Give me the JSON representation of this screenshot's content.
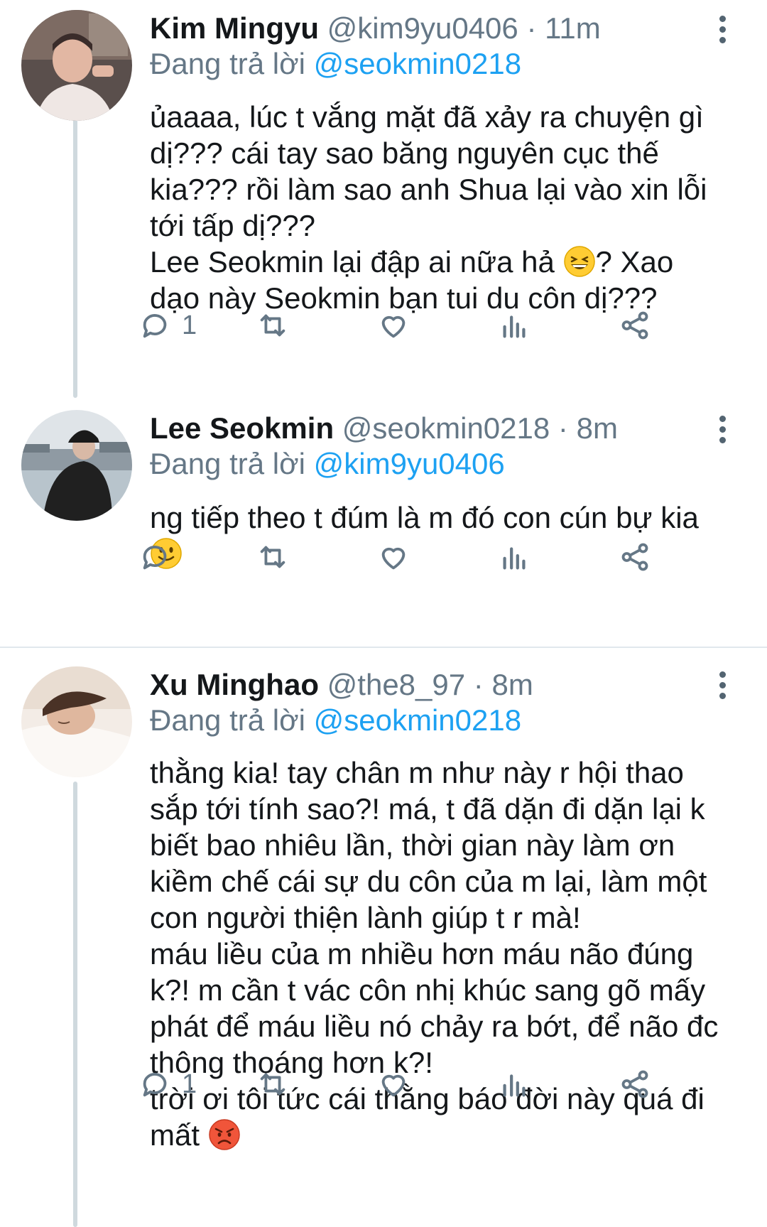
{
  "tweets": [
    {
      "name": "Kim Mingyu",
      "handle": "@kim9yu0406",
      "separator": "·",
      "time": "11m",
      "reply_prefix": "Đang trả lời",
      "reply_to": "@seokmin0218",
      "lines": [
        "ủaaaa, lúc t vắng mặt đã xảy ra chuyện gì",
        "dị??? cái tay sao băng nguyên cục thế",
        "kia??? rồi làm sao anh Shua lại vào xin lỗi",
        "tới tấp dị???",
        "Lee Seokmin lại đập ai nữa hả",
        "? Xao",
        "dạo này Seokmin bạn tui du côn dị???"
      ],
      "reply_count": "1",
      "emoji_1": "grinning-squint-face"
    },
    {
      "name": "Lee Seokmin",
      "handle": "@seokmin0218",
      "separator": "·",
      "time": "8m",
      "reply_prefix": "Đang trả lời",
      "reply_to": "@kim9yu0406",
      "lines": [
        "ng tiếp theo t đúm là m đó con cún bự kia"
      ],
      "reply_count": "",
      "emoji_1": "slightly-smiling-face"
    },
    {
      "name": "Xu Minghao",
      "handle": "@the8_97",
      "separator": "·",
      "time": "8m",
      "reply_prefix": "Đang trả lời",
      "reply_to": "@seokmin0218",
      "lines": [
        "thằng kia! tay chân m như này r hội thao",
        "sắp tới tính sao?! má, t đã dặn đi dặn lại k",
        "biết bao nhiêu lần, thời gian này làm ơn",
        "kiềm chế cái sự du côn của m lại, làm một",
        "con người thiện lành giúp t r mà!",
        "máu liều của m nhiều hơn máu não đúng",
        "k?! m cần t vác côn nhị khúc sang gõ mấy",
        "phát để máu liều nó chảy ra bớt, để não đc",
        "thông thoáng hơn k?!",
        "trời ơi tôi tức cái thằng báo đời này quá đi",
        "mất"
      ],
      "reply_count": "1",
      "emoji_1": "pouting-face"
    }
  ],
  "colors": {
    "text": "#14171a",
    "muted": "#657786",
    "link": "#1da1f2",
    "icon": "#657786",
    "divider": "#e1e8ed"
  }
}
